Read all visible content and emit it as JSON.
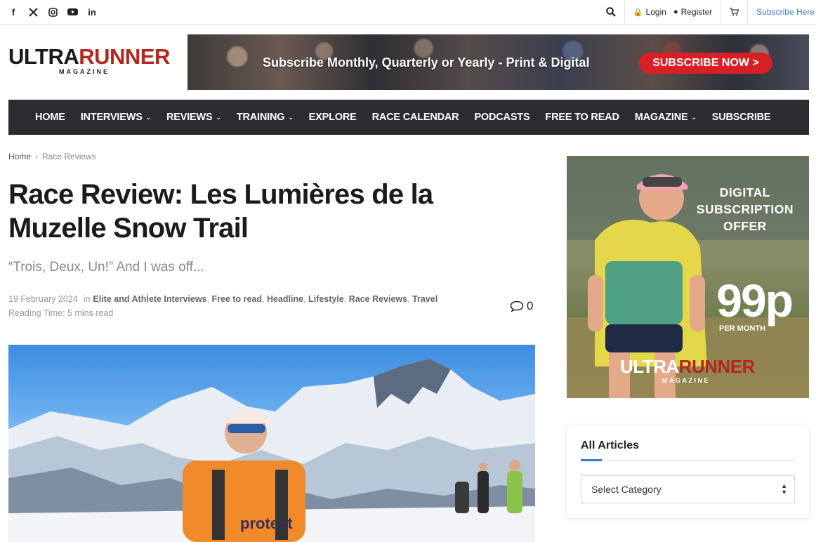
{
  "topbar": {
    "social": [
      "facebook-icon",
      "x-icon",
      "instagram-icon",
      "youtube-icon",
      "linkedin-icon"
    ],
    "login": "Login",
    "register": "Register",
    "subscribe": "Subscribe Here"
  },
  "brand": {
    "word1": "ULTRA",
    "word2": "RUNNER",
    "sub": "MAGAZINE"
  },
  "banner": {
    "text": "Subscribe Monthly, Quarterly or Yearly - Print & Digital",
    "button": "SUBSCRIBE NOW >"
  },
  "nav": {
    "items": [
      {
        "label": "HOME",
        "dropdown": false
      },
      {
        "label": "INTERVIEWS",
        "dropdown": true
      },
      {
        "label": "REVIEWS",
        "dropdown": true
      },
      {
        "label": "TRAINING",
        "dropdown": true
      },
      {
        "label": "EXPLORE",
        "dropdown": false
      },
      {
        "label": "RACE CALENDAR",
        "dropdown": false
      },
      {
        "label": "PODCASTS",
        "dropdown": false
      },
      {
        "label": "FREE TO READ",
        "dropdown": false
      },
      {
        "label": "MAGAZINE",
        "dropdown": true
      },
      {
        "label": "SUBSCRIBE",
        "dropdown": false
      }
    ]
  },
  "breadcrumb": {
    "home": "Home",
    "current": "Race Reviews"
  },
  "article": {
    "title": "Race Review: Les Lumières de la Muzelle Snow Trail",
    "subtitle": "“Trois, Deux, Un!” And I was off...",
    "date": "19 February 2024",
    "in": "in",
    "categories": [
      "Elite and Athlete Interviews",
      "Free to read",
      "Headline",
      "Lifestyle",
      "Race Reviews",
      "Travel"
    ],
    "reading_time": "Reading Time: 5 mins read",
    "comments": "0"
  },
  "ad": {
    "line1": "DIGITAL",
    "line2": "SUBSCRIPTION",
    "line3": "OFFER",
    "price": "99p",
    "per_month": "PER MONTH",
    "logo1": "ULTRA",
    "logo2": "RUNNER",
    "logo_sub": "MAGAZINE"
  },
  "widget": {
    "title": "All Articles",
    "select_value": "Select Category"
  },
  "colors": {
    "accent": "#3a7bd5",
    "brand_red": "#b4271f",
    "nav_bg": "#2a2c30",
    "cta_red": "#d91f26"
  }
}
